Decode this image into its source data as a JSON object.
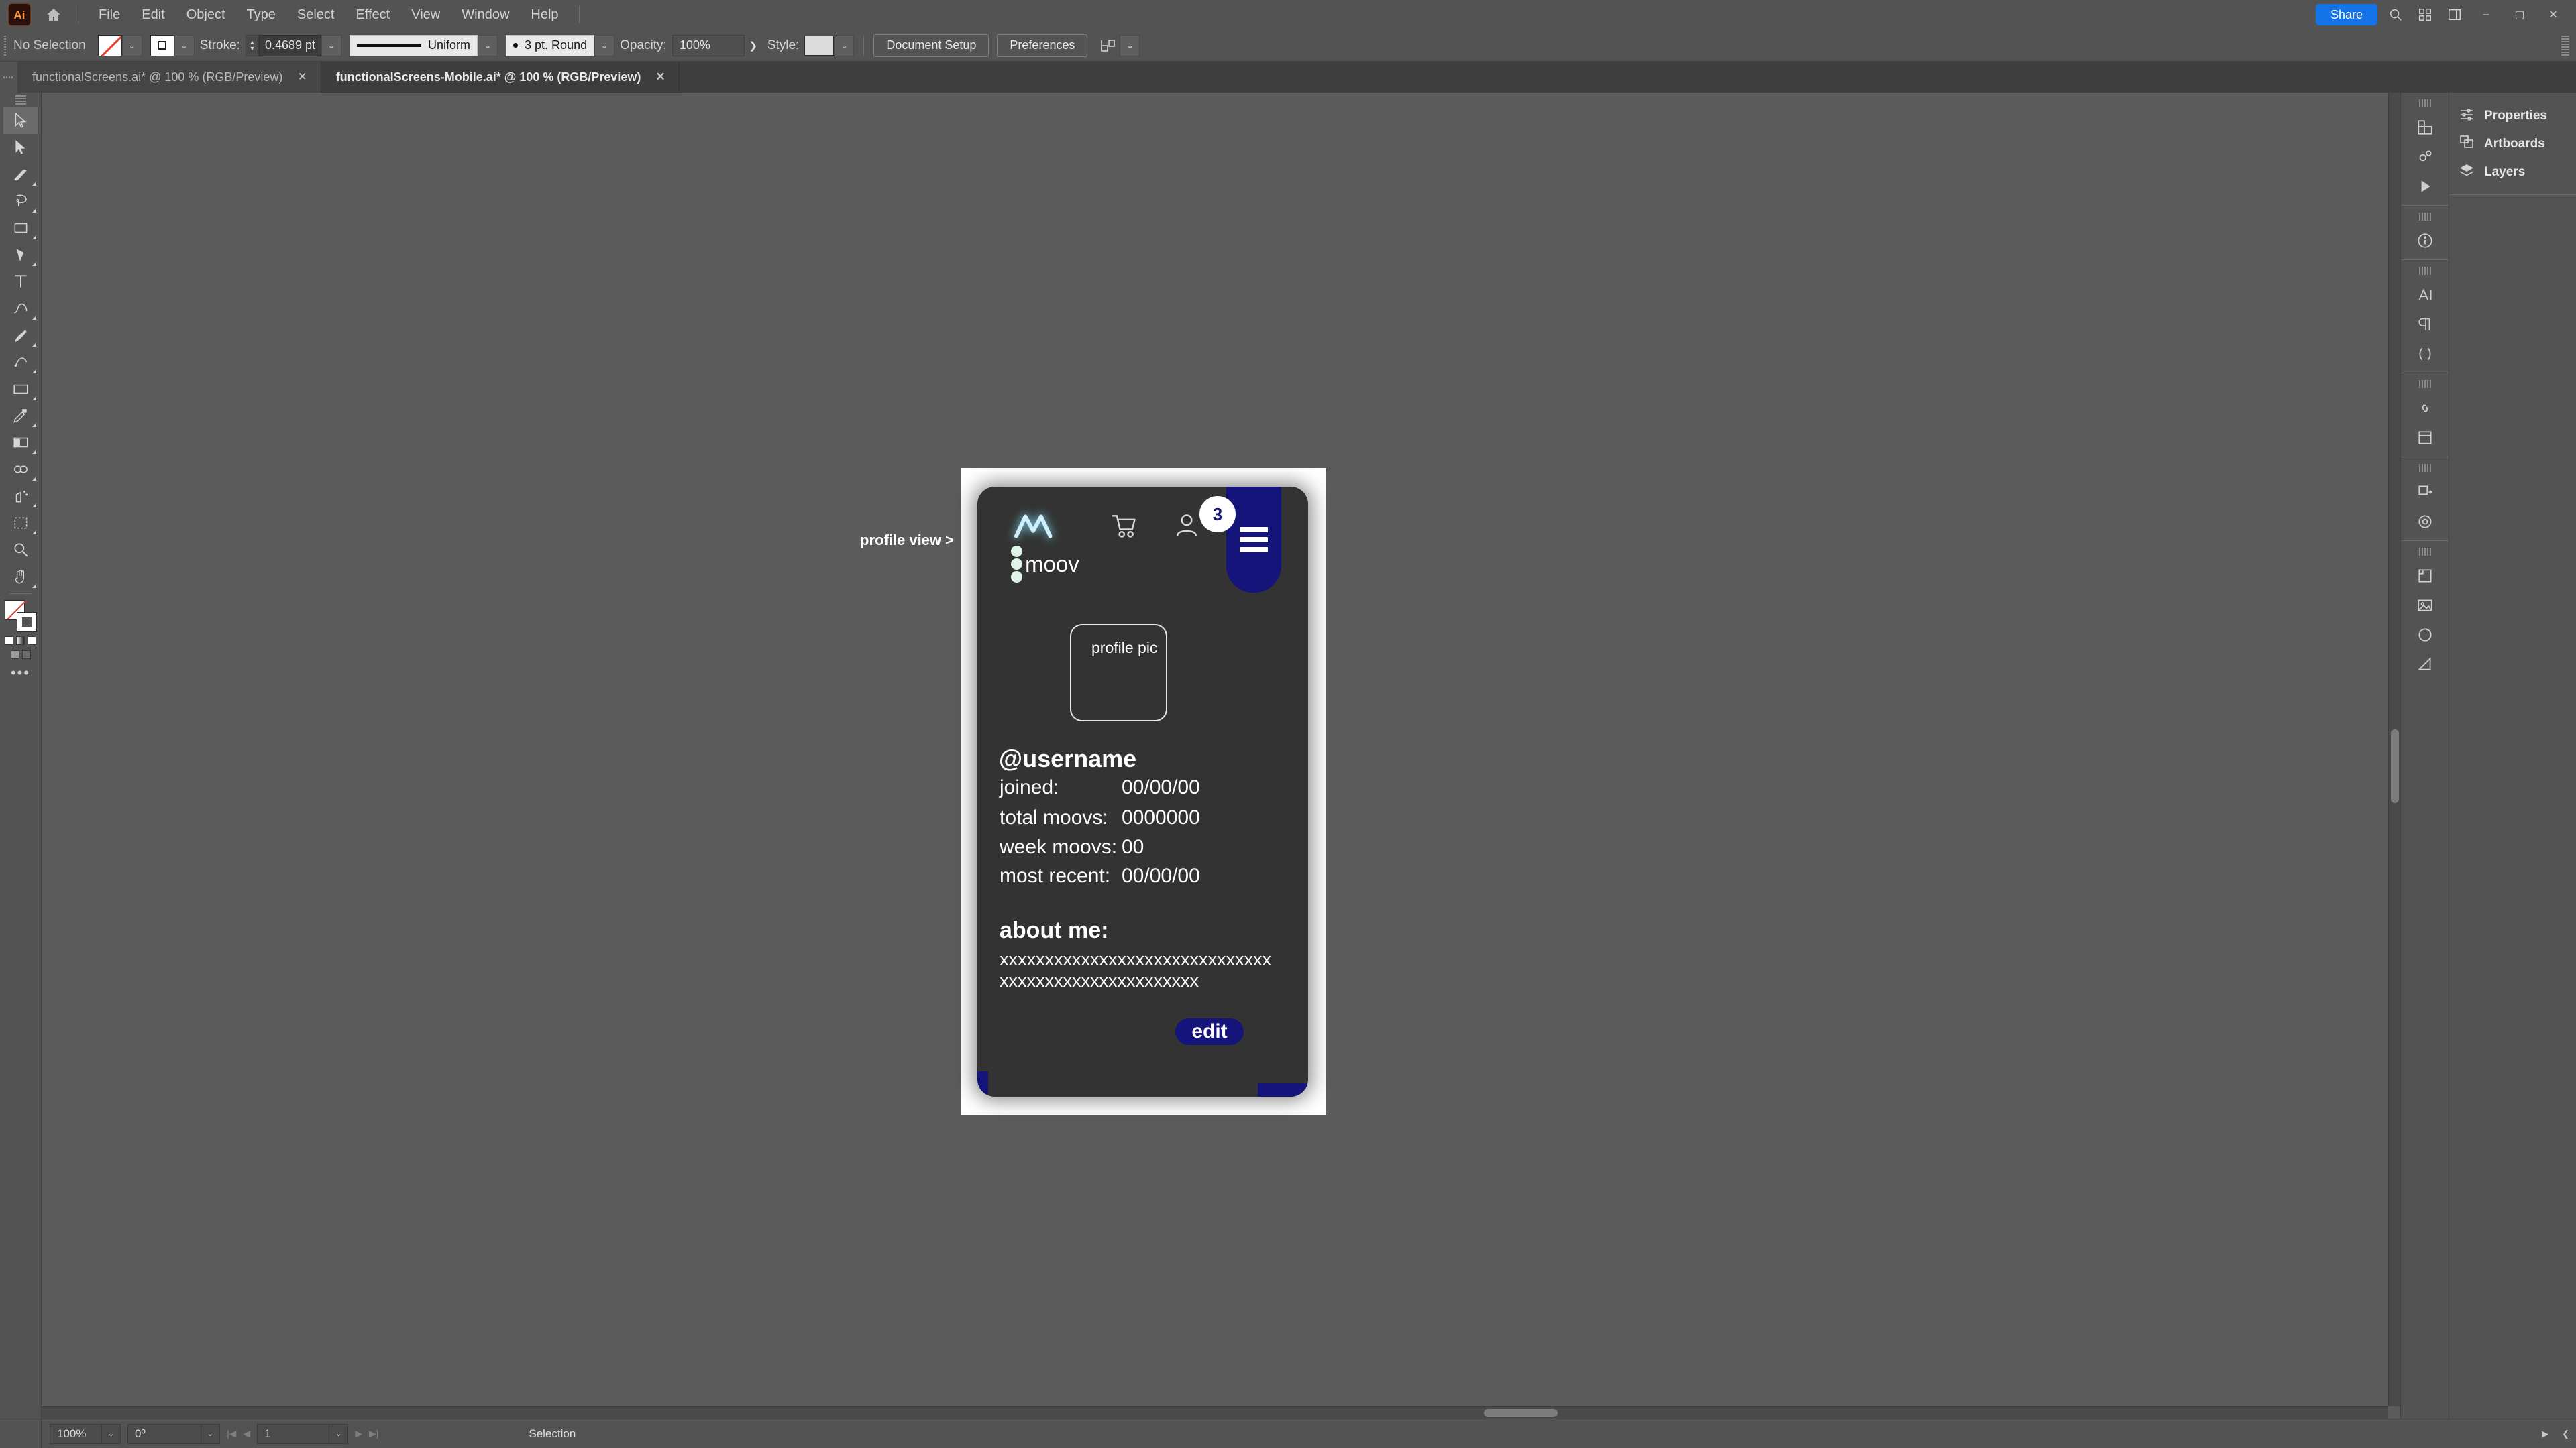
{
  "app": {
    "logo_text": "Ai",
    "home_icon": "home-icon",
    "share_label": "Share",
    "search_icon": "search-icon",
    "grid_icon": "grid-icon",
    "panel_icon": "panel-layout-icon",
    "minimize": "–",
    "maximize": "▢",
    "close": "✕"
  },
  "menu": {
    "items": [
      {
        "label": "File"
      },
      {
        "label": "Edit"
      },
      {
        "label": "Object"
      },
      {
        "label": "Type"
      },
      {
        "label": "Select"
      },
      {
        "label": "Effect"
      },
      {
        "label": "View"
      },
      {
        "label": "Window"
      },
      {
        "label": "Help"
      }
    ]
  },
  "controlbar": {
    "selection_status": "No Selection",
    "fill_swatch": "none-fill-swatch",
    "stroke_swatch": "stroke-swatch",
    "stroke_label": "Stroke:",
    "stroke_weight": "0.4689 pt",
    "stroke_profile": "Uniform",
    "brush_definition": "3 pt. Round",
    "opacity_label": "Opacity:",
    "opacity_value": "100%",
    "style_label": "Style:",
    "document_setup_label": "Document Setup",
    "preferences_label": "Preferences",
    "align_icon": "align-objects-icon",
    "caret": "⌄"
  },
  "tabs": [
    {
      "title": "functionalScreens.ai* @ 100 % (RGB/Preview)",
      "close": "✕",
      "active": false
    },
    {
      "title": "functionalScreens-Mobile.ai* @ 100 % (RGB/Preview)",
      "close": "✕",
      "active": true
    }
  ],
  "tools": [
    {
      "name": "selection-tool",
      "selected": true
    },
    {
      "name": "direct-selection-tool",
      "selected": false
    },
    {
      "name": "magic-wand-tool",
      "selected": false
    },
    {
      "name": "lasso-tool",
      "selected": false
    },
    {
      "name": "rectangle-frame-tool",
      "selected": false
    },
    {
      "name": "pen-tool",
      "selected": false
    },
    {
      "name": "type-tool",
      "selected": false
    },
    {
      "name": "curvature-tool",
      "selected": false
    },
    {
      "name": "paintbrush-tool",
      "selected": false
    },
    {
      "name": "shaper-tool",
      "selected": false
    },
    {
      "name": "rectangle-tool",
      "selected": false
    },
    {
      "name": "eyedropper-tool",
      "selected": false
    },
    {
      "name": "gradient-tool",
      "selected": false
    },
    {
      "name": "blend-tool",
      "selected": false
    },
    {
      "name": "symbol-sprayer-tool",
      "selected": false
    },
    {
      "name": "artboard-tool",
      "selected": false
    },
    {
      "name": "zoom-tool",
      "selected": false
    },
    {
      "name": "hand-tool",
      "selected": false
    }
  ],
  "canvas": {
    "artboard_label": "profile view >"
  },
  "mockup": {
    "brand_name": "moov",
    "logo_icon": "moov-logo-icon",
    "cart_icon": "shopping-cart-icon",
    "account_icon": "user-account-icon",
    "menu_icon": "hamburger-menu-icon",
    "notification_count": "3",
    "profile_pic_label": "profile pic",
    "username": "@username",
    "stats": [
      {
        "label": "joined:",
        "value": "00/00/00"
      },
      {
        "label": "total moovs:",
        "value": "0000000"
      },
      {
        "label": "week moovs:",
        "value": "00"
      },
      {
        "label": "most recent:",
        "value": "00/00/00"
      }
    ],
    "about_title": "about me:",
    "about_lines": [
      "xxxxxxxxxxxxxxxxxxxxxxxxxxxxxx",
      "xxxxxxxxxxxxxxxxxxxxxx"
    ],
    "edit_label": "edit",
    "accent_color": "#14147a",
    "background_color": "#333333"
  },
  "rail_icons": [
    {
      "name": "color-panel-icon"
    },
    {
      "name": "brushes-panel-icon"
    },
    {
      "name": "symbols-panel-icon"
    },
    {
      "name": "graphic-styles-icon"
    },
    {
      "name": "gear-panel-icon"
    },
    {
      "name": "play-action-icon"
    },
    {
      "name": "info-icon"
    },
    {
      "name": "character-panel-icon"
    },
    {
      "name": "paragraph-panel-icon"
    },
    {
      "name": "glyphs-panel-icon"
    },
    {
      "name": "links-panel-icon"
    },
    {
      "name": "separate-panel-icon"
    },
    {
      "name": "transform-panel-icon"
    },
    {
      "name": "appearance-panel-icon"
    },
    {
      "name": "artboards-panel-icon"
    },
    {
      "name": "image-trace-icon"
    },
    {
      "name": "swatches-panel-icon"
    },
    {
      "name": "gradient-panel-icon"
    }
  ],
  "panels": [
    {
      "label": "Properties",
      "icon": "sliders-icon"
    },
    {
      "label": "Artboards",
      "icon": "artboards-icon"
    },
    {
      "label": "Layers",
      "icon": "layers-icon"
    }
  ],
  "statusbar": {
    "zoom": "100%",
    "rotation": "0º",
    "artboard_number": "1",
    "tool_status": "Selection",
    "first_icon": "first-artboard-icon",
    "prev_icon": "prev-artboard-icon",
    "next_icon": "next-artboard-icon",
    "last_icon": "last-artboard-icon",
    "caret": "⌄"
  }
}
